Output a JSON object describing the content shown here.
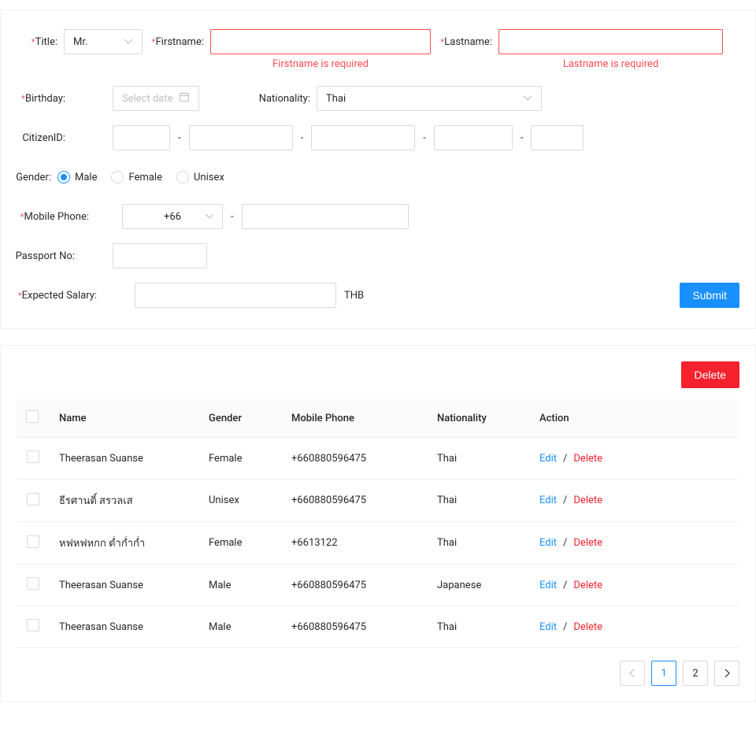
{
  "form": {
    "title": {
      "label": "Title",
      "value": "Mr."
    },
    "firstname": {
      "label": "Firstname",
      "value": "",
      "error": "Firstname is required"
    },
    "lastname": {
      "label": "Lastname",
      "value": "",
      "error": "Lastname is required"
    },
    "birthday": {
      "label": "Birthday",
      "placeholder": "Select date"
    },
    "nationality": {
      "label": "Nationality",
      "value": "Thai"
    },
    "citizenid": {
      "label": "CitizenID",
      "dash": "-"
    },
    "genderLabel": "Gender",
    "gender": {
      "options": [
        {
          "label": "Male",
          "checked": true
        },
        {
          "label": "Female",
          "checked": false
        },
        {
          "label": "Unisex",
          "checked": false
        }
      ]
    },
    "mobile": {
      "label": "Mobile Phone",
      "prefix": "+66",
      "dash": "-"
    },
    "passport": {
      "label": "Passport No"
    },
    "salary": {
      "label": "Expected Salary",
      "suffix": "THB"
    },
    "submit": "Submit"
  },
  "table": {
    "deleteButton": "Delete",
    "columns": {
      "name": "Name",
      "gender": "Gender",
      "mobile": "Mobile Phone",
      "nationality": "Nationality",
      "action": "Action"
    },
    "actions": {
      "edit": "Edit",
      "delete": "Delete",
      "sep": "/"
    },
    "rows": [
      {
        "name": "Theerasan Suanse",
        "gender": "Female",
        "mobile": "+660880596475",
        "nationality": "Thai"
      },
      {
        "name": "ธีรศานติ์ สรวลเส",
        "gender": "Unisex",
        "mobile": "+660880596475",
        "nationality": "Thai"
      },
      {
        "name": "หฟหฟหกก ด่ำก่ำก่ำ",
        "gender": "Female",
        "mobile": "+6613122",
        "nationality": "Thai"
      },
      {
        "name": "Theerasan Suanse",
        "gender": "Male",
        "mobile": "+660880596475",
        "nationality": "Japanese"
      },
      {
        "name": "Theerasan Suanse",
        "gender": "Male",
        "mobile": "+660880596475",
        "nationality": "Thai"
      }
    ]
  },
  "pagination": {
    "prev": "<",
    "next": ">",
    "pages": [
      "1",
      "2"
    ],
    "active": 1
  }
}
